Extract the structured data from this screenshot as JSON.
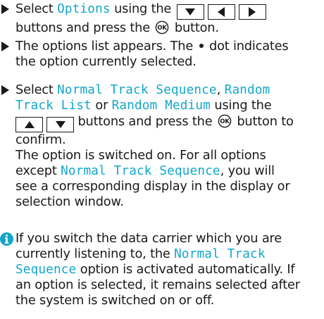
{
  "step1": {
    "part1": "Select ",
    "option": "Options",
    "part2": " using the ",
    "line2_part1": "buttons and press the ",
    "line2_part2": " button."
  },
  "step2": {
    "line1_part1": "The options list appears. The ",
    "line1_part2": " dot indicates",
    "line2": "the option currently selected."
  },
  "step3": {
    "part1": "Select ",
    "opt1": "Normal Track Sequence",
    "comma": ", ",
    "opt2a": "Random",
    "opt2b": "Track List",
    "or": " or ",
    "opt3": "Random Medium",
    "using": " using the",
    "buttons_press": " buttons and press the ",
    "button_to": " button to",
    "confirm": "confirm.",
    "result_line1": "The option is switched on. For all options",
    "except": "except ",
    "opt1_again": "Normal Track Sequence",
    "result_line2_rest": ", you will",
    "result_line3": "see a corresponding display in the display or",
    "result_line4": "selection window."
  },
  "note": {
    "line1": "If you switch the data carrier which you are",
    "line2_part1": "currently listening to, the ",
    "line2_hl": "Normal Track",
    "line3_hl": "Sequence",
    "line3_rest": " option is activated automatically. If",
    "line4": "an option is selected, it remains selected after",
    "line5": "the system is switched on or off."
  },
  "icons": {
    "accent_color": "#12a6cc",
    "text_color": "#1a1a1a",
    "buttons": [
      "down-arrow-icon",
      "left-arrow-icon",
      "right-arrow-icon",
      "up-arrow-icon",
      "ok-button-icon",
      "info-icon"
    ]
  }
}
